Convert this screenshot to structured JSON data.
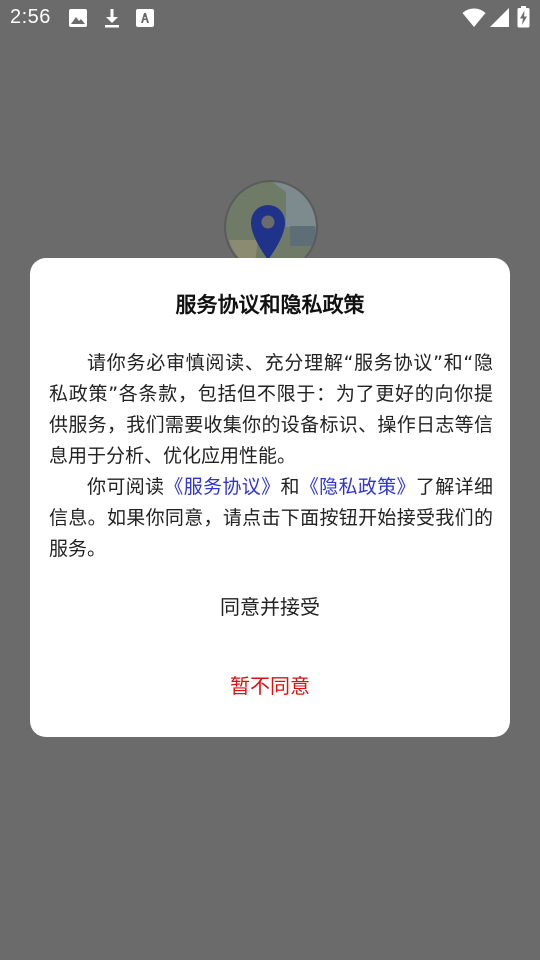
{
  "status_bar": {
    "time": "2:56",
    "icons": [
      "image-icon",
      "download-icon",
      "text-a-icon",
      "wifi-icon",
      "signal-icon",
      "battery-charging-icon"
    ]
  },
  "background": {
    "app_logo_icon": "map-pin-logo-icon"
  },
  "dialog": {
    "title": "服务协议和隐私政策",
    "para1": "请你务必审慎阅读、充分理解“服务协议”和“隐私政策”各条款，包括但不限于：为了更好的向你提供服务，我们需要收集你的设备标识、操作日志等信息用于分析、优化应用性能。",
    "para2_prefix": "你可阅读",
    "link_service": "《服务协议》",
    "para2_and": "和",
    "link_privacy": "《隐私政策》",
    "para2_suffix": "了解详细信息。如果你同意，请点击下面按钮开始接受我们的服务。",
    "agree_label": "同意并接受",
    "decline_label": "暂不同意"
  },
  "colors": {
    "overlay": "#6b6b6b",
    "link": "#2f34d3",
    "decline": "#dd1010"
  }
}
